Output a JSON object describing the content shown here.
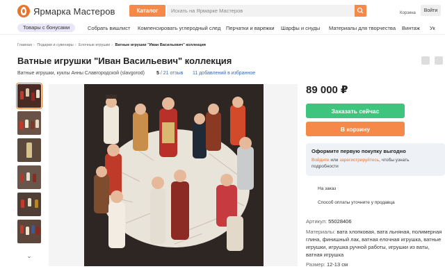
{
  "header": {
    "logo_text": "Ярмарка Мастеров",
    "catalog_label": "Каталог",
    "search_placeholder": "Искать на Ярмарке Мастеров",
    "cart_label": "Корзина",
    "login_label": "Войти"
  },
  "nav": {
    "items": [
      "Товары с бонусами",
      "Собрать вишлист",
      "Компенсировать углеродный след",
      "Перчатки и варежки",
      "Шарфы и снуды",
      "Материалы для творчества",
      "Винтаж",
      "Ук"
    ]
  },
  "breadcrumb": [
    "Главная",
    "Подарки и сувениры",
    "Елочные игрушки",
    "Ватные игрушки \"Иван Васильевич\" коллекция"
  ],
  "product": {
    "title": "Ватные игрушки \"Иван Васильевич\" коллекция",
    "seller": "Ватные игрушки, куклы Анны Славгородской (slavgorod)",
    "rating": "5",
    "reviews": "/ 21 отзыв",
    "favorites": "11 добавлений в избранное",
    "price": "89 000 ₽",
    "order_label": "Заказать сейчас",
    "cart_label": "В корзину"
  },
  "promo": {
    "title": "Оформите первую покупку выгодно",
    "login_link": "Войдите",
    "or_text": " или ",
    "register_link": "зарегистрируйтесь",
    "rest_text": ", чтобы узнать подробности"
  },
  "info": {
    "made_to_order": "На заказ",
    "payment": "Способ оплаты уточните у продавца"
  },
  "details": {
    "article_label": "Артикул:",
    "article_value": "55028406",
    "materials_label": "Материалы:",
    "materials_value": "вата хлопковая, вата льняная, полимерная глина, финишный лак, ватная елочная игрушка, ватные игрушки, игрушка ручной работы, игрушки из ваты, ватная игрушка",
    "size_label": "Размер:",
    "size_value": "12-13 см"
  },
  "colors": {
    "accent": "#f5894a",
    "green": "#3ec47d",
    "link": "#3b6ab0"
  }
}
